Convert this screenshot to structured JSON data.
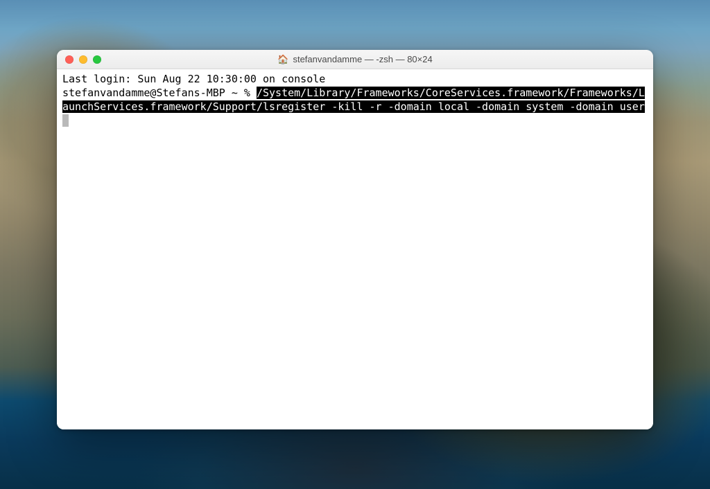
{
  "window": {
    "title": "stefanvandamme — -zsh — 80×24",
    "icon": "home-icon"
  },
  "trafficLights": {
    "close": "close",
    "minimize": "minimize",
    "zoom": "zoom"
  },
  "terminal": {
    "lastLoginLine": "Last login: Sun Aug 22 10:30:00 on console",
    "prompt": "stefanvandamme@Stefans-MBP ~ % ",
    "selectedCommand": "/System/Library/Frameworks/CoreServices.framework/Frameworks/LaunchServices.framework/Support/lsregister -kill -r -domain local -domain system -domain user"
  }
}
